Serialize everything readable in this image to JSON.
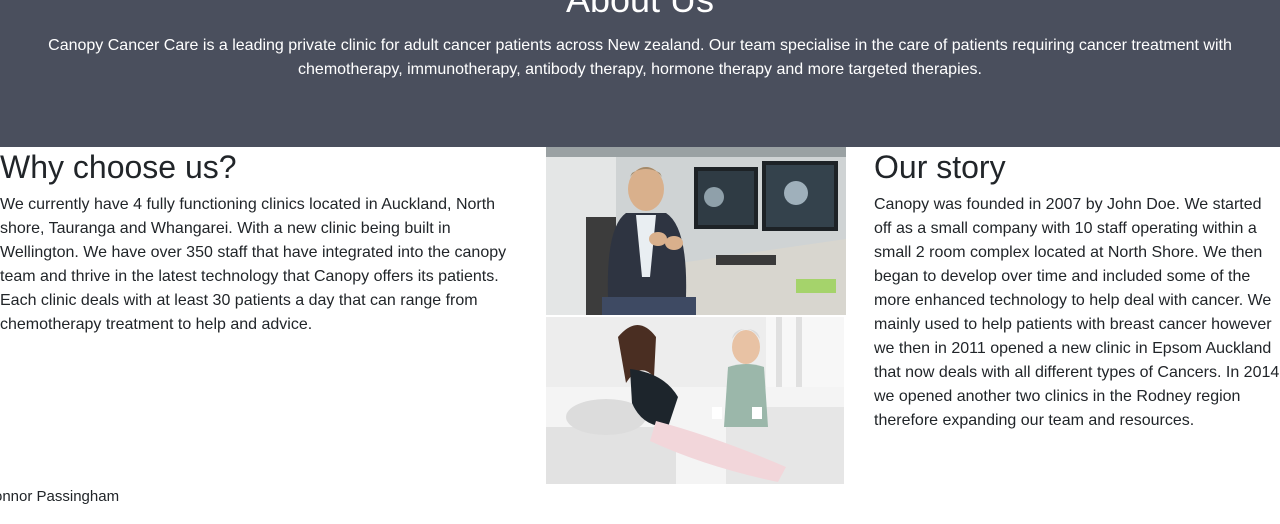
{
  "hero": {
    "title": "About Us",
    "description": "Canopy Cancer Care is a leading private clinic for adult cancer patients across New zealand. Our team specialise in the care of patients requiring cancer treatment with chemotherapy, immunotherapy, antibody therapy, hormone therapy and more targeted therapies."
  },
  "why": {
    "title": "Why choose us?",
    "text": "We currently have 4 fully functioning clinics located in Auckland, North shore, Tauranga and Whangarei. With a new clinic being built in Wellington. We have over 350 staff that have integrated into the canopy team and thrive in the latest technology that Canopy offers its patients. Each clinic deals with at least 30 patients a day that can range from chemotherapy treatment to help and advice."
  },
  "story": {
    "title": "Our story",
    "text": "Canopy was founded in 2007 by John Doe. We started off as a small company with 10 staff operating within a small 2 room complex located at North Shore. We then began to develop over time and included some of the more enhanced technology to help deal with cancer. We mainly used to help patients with breast cancer however we then in 2011 opened a new clinic in Epsom Auckland that now deals with all different types of Cancers. In 2014 we opened another two clinics in the Rodney region therefore expanding our team and resources."
  },
  "footer": {
    "name": "onnor Passingham"
  },
  "colors": {
    "hero_bg": "#4a4f5d",
    "text": "#212529"
  }
}
